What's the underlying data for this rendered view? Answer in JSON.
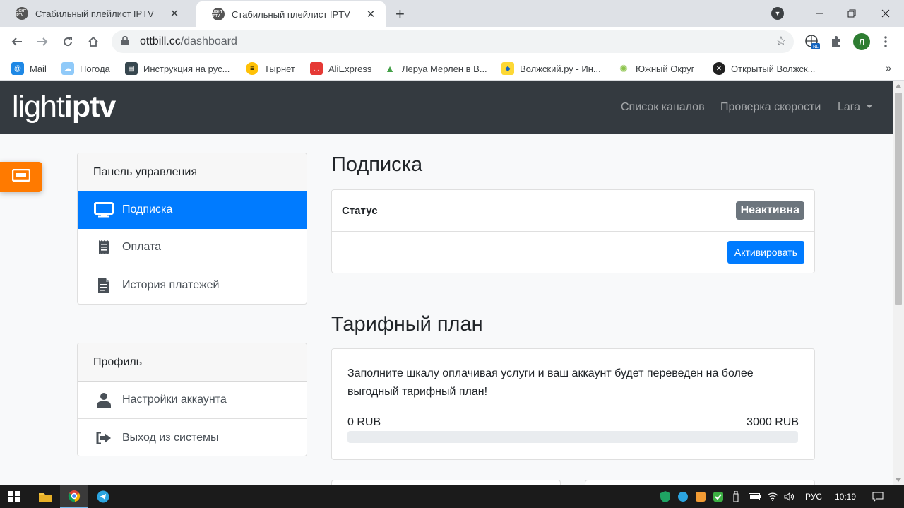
{
  "browser": {
    "tabs": [
      {
        "title": "Стабильный плейлист IPTV",
        "icon": "lightiptv-favicon",
        "active": false
      },
      {
        "title": "Стабильный плейлист IPTV",
        "icon": "lightiptv-favicon",
        "active": true
      }
    ],
    "favicon_text": "LIGHT IPTV",
    "url_host": "ottbill.cc",
    "url_path": "/dashboard",
    "profile_initial": "Л",
    "ext_badge": "NL",
    "bookmarks": [
      {
        "label": "Mail",
        "icon": "mail-icon",
        "color": "#1e88e5"
      },
      {
        "label": "Погода",
        "icon": "weather-icon",
        "color": "#90caf9"
      },
      {
        "label": "Инструкция на рус...",
        "icon": "document-icon",
        "color": "#37474f"
      },
      {
        "label": "Тырнет",
        "icon": "beeline-icon",
        "color": "#ffc107"
      },
      {
        "label": "AliExpress",
        "icon": "aliexpress-icon",
        "color": "#e53935"
      },
      {
        "label": "Леруа Мерлен в В...",
        "icon": "leroy-icon",
        "color": "#43a047"
      },
      {
        "label": "Волжский.ру - Ин...",
        "icon": "volzhsky-icon",
        "color": "#fdd835"
      },
      {
        "label": "Южный Округ",
        "icon": "south-icon",
        "color": "#8bc34a"
      },
      {
        "label": "Открытый Волжск...",
        "icon": "open-icon",
        "color": "#212121"
      }
    ]
  },
  "site": {
    "logo_light": "light",
    "logo_iptv": "iptv",
    "nav": {
      "channels": "Список каналов",
      "speed": "Проверка скорости",
      "user": "Lara"
    },
    "sidebar_panel": {
      "header": "Панель управления",
      "items": [
        {
          "label": "Подписка",
          "icon": "monitor-icon",
          "active": true
        },
        {
          "label": "Оплата",
          "icon": "receipt-icon",
          "active": false
        },
        {
          "label": "История платежей",
          "icon": "file-list-icon",
          "active": false
        }
      ]
    },
    "sidebar_profile": {
      "header": "Профиль",
      "items": [
        {
          "label": "Настройки аккаунта",
          "icon": "user-icon"
        },
        {
          "label": "Выход из системы",
          "icon": "sign-out-icon"
        }
      ]
    },
    "subscription": {
      "title": "Подписка",
      "status_label": "Статус",
      "status_value": "Неактивна",
      "activate_button": "Активировать"
    },
    "tariff": {
      "title": "Тарифный план",
      "description": "Заполните шкалу оплачивая услуги и ваш аккаунт будет переведен на более выгодный тарифный план!",
      "range_min": "0 RUB",
      "range_max": "3000 RUB",
      "progress_percent": 0
    },
    "colors": {
      "navbar": "#343a40",
      "primary": "#007bff",
      "badge": "#6c757d",
      "float_button": "#ff7a00"
    }
  },
  "taskbar": {
    "language": "РУС",
    "time": "10:19"
  }
}
